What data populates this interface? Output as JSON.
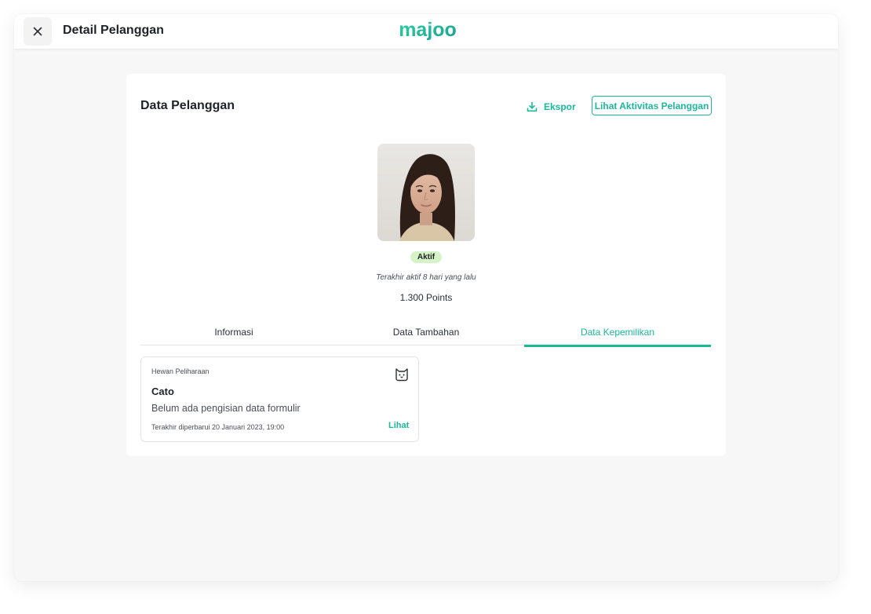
{
  "header": {
    "title": "Detail Pelanggan",
    "logo_text": "majoo",
    "close_icon": "close-icon"
  },
  "customer": {
    "section_title": "Data Pelanggan",
    "export_label": "Ekspor",
    "activity_button_label": "Lihat Aktivitas Pelanggan",
    "status": "Aktif",
    "last_active": "Terakhir aktif 8 hari yang lalu",
    "points": "1.300 Points"
  },
  "tabs": [
    {
      "label": "Informasi",
      "active": false
    },
    {
      "label": "Data Tambahan",
      "active": false
    },
    {
      "label": "Data Kepemilikan",
      "active": true
    }
  ],
  "ownership_cards": [
    {
      "category": "Hewan Peliharaan",
      "name": "Cato",
      "description": "Belum ada pengisian data formulir",
      "updated": "Terakhir diperbarui 20 Januari 2023, 19:00",
      "link_label": "Lihat",
      "icon": "cat-icon"
    }
  ],
  "colors": {
    "accent": "#19b99a",
    "status_badge_bg": "#d6f3c8",
    "background": "#f7f7f7"
  }
}
